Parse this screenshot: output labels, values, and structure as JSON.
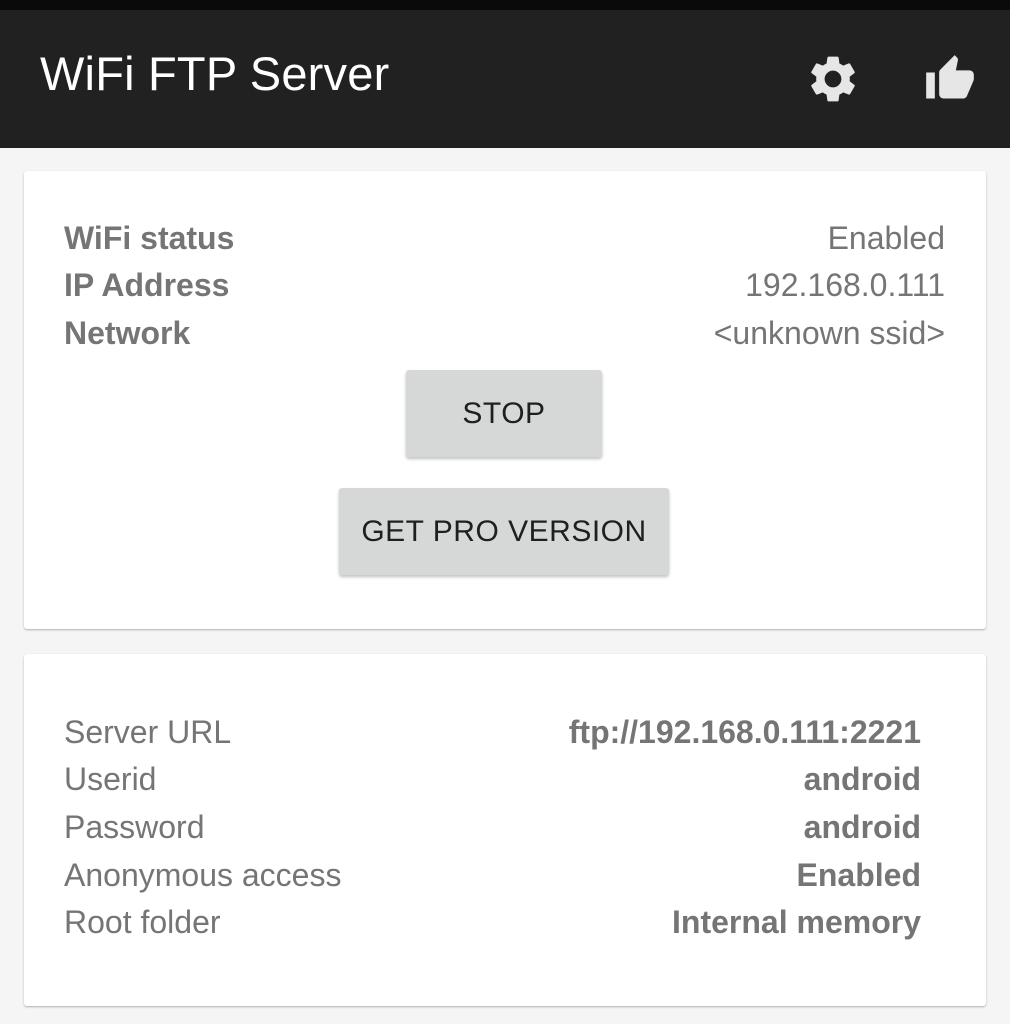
{
  "app": {
    "title": "WiFi FTP Server",
    "icons": {
      "settings": "gear-icon",
      "rate": "thumbs-up-icon"
    },
    "colors": {
      "app_bar": "#212121",
      "title_text": "#ffffff",
      "icon": "#e6e6e6",
      "background": "#f5f5f5",
      "card": "#ffffff",
      "text_secondary": "#757575",
      "button": "#d6d7d7",
      "button_text": "#1f1f1f"
    }
  },
  "status": {
    "rows": [
      {
        "label": "WiFi status",
        "value": "Enabled"
      },
      {
        "label": "IP Address",
        "value": "192.168.0.111"
      },
      {
        "label": "Network",
        "value": "<unknown ssid>"
      }
    ],
    "stop_label": "STOP",
    "pro_label": "GET PRO VERSION"
  },
  "server": {
    "rows": [
      {
        "label": "Server URL",
        "value": "ftp://192.168.0.111:2221"
      },
      {
        "label": "Userid",
        "value": "android"
      },
      {
        "label": "Password",
        "value": "android"
      },
      {
        "label": "Anonymous access",
        "value": "Enabled"
      },
      {
        "label": "Root folder",
        "value": "Internal memory"
      }
    ]
  }
}
